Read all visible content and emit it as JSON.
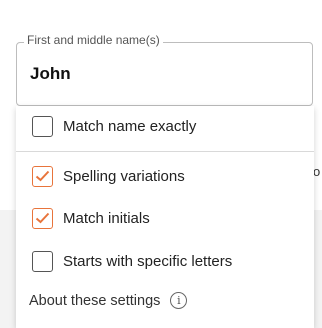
{
  "name_field": {
    "legend": "First and middle name(s)",
    "value": "John"
  },
  "background_fragment": "o",
  "options": [
    {
      "label": "Match name exactly",
      "checked": false
    },
    {
      "label": "Spelling variations",
      "checked": true
    },
    {
      "label": "Match initials",
      "checked": true
    },
    {
      "label": "Starts with specific letters",
      "checked": false
    }
  ],
  "about": {
    "label": "About these settings",
    "icon": "info-icon"
  },
  "colors": {
    "check_accent": "#e8743b"
  }
}
